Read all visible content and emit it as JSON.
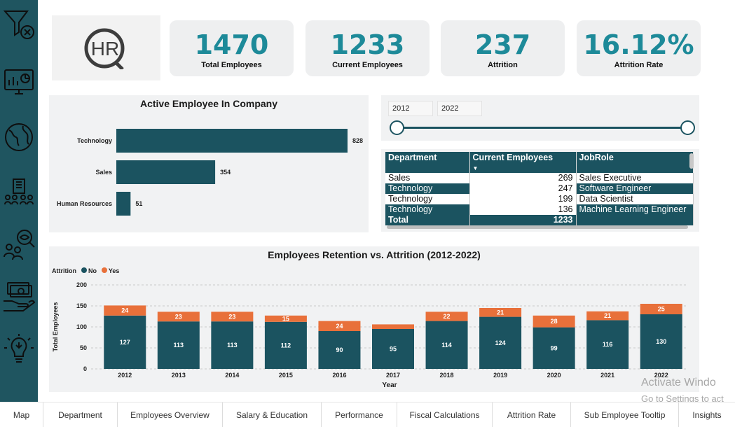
{
  "kpis": [
    {
      "value": "1470",
      "label": "Total Employees"
    },
    {
      "value": "1233",
      "label": "Current Employees"
    },
    {
      "value": "237",
      "label": "Attrition"
    },
    {
      "value": "16.12%",
      "label": "Attrition Rate"
    }
  ],
  "logo_text": "HR",
  "active_chart": {
    "title": "Active Employee In Company"
  },
  "date_slicer": {
    "start": "2012",
    "end": "2022"
  },
  "table": {
    "headers": [
      "Department",
      "Current Employees",
      "JobRole"
    ],
    "rows": [
      [
        "Sales",
        "269",
        "Sales Executive"
      ],
      [
        "Technology",
        "247",
        "Software Engineer"
      ],
      [
        "Technology",
        "199",
        "Data Scientist"
      ],
      [
        "Technology",
        "136",
        "Machine Learning Engineer"
      ]
    ],
    "total_label": "Total",
    "total_value": "1233"
  },
  "retention_chart": {
    "title": "Employees Retention vs. Attrition (2012-2022)",
    "legend_title": "Attrition",
    "legend_no": "No",
    "legend_yes": "Yes",
    "xlabel": "Year",
    "ylabel": "Total Employees"
  },
  "chart_data": [
    {
      "type": "bar",
      "title": "Active Employee In Company",
      "orientation": "horizontal",
      "categories": [
        "Technology",
        "Sales",
        "Human Resources"
      ],
      "values": [
        828,
        354,
        51
      ],
      "color": "#1b5360"
    },
    {
      "type": "bar",
      "stacked": true,
      "title": "Employees Retention vs. Attrition (2012-2022)",
      "xlabel": "Year",
      "ylabel": "Total Employees",
      "categories": [
        "2012",
        "2013",
        "2014",
        "2015",
        "2016",
        "2017",
        "2018",
        "2019",
        "2020",
        "2021",
        "2022"
      ],
      "series": [
        {
          "name": "No",
          "color": "#1b5360",
          "values": [
            127,
            113,
            113,
            112,
            90,
            95,
            114,
            124,
            99,
            116,
            130
          ]
        },
        {
          "name": "Yes",
          "color": "#e8703a",
          "values": [
            24,
            23,
            23,
            15,
            24,
            11,
            22,
            21,
            28,
            21,
            25
          ]
        }
      ],
      "yticks": [
        0,
        50,
        100,
        150,
        200
      ],
      "ylim": [
        0,
        200
      ],
      "legend": "top-left",
      "grid": true
    }
  ],
  "tabs": [
    "Map",
    "Department",
    "Employees Overview",
    "Salary & Education",
    "Performance",
    "Fiscal Calculations",
    "Attrition Rate",
    "Sub Employee Tooltip",
    "Insights"
  ],
  "watermark": {
    "line1": "Activate Windo",
    "line2": "Go to Settings to act"
  },
  "sidebar_icons": [
    "clear-filter-icon",
    "dashboard-icon",
    "globe-icon",
    "organization-icon",
    "employee-search-icon",
    "salary-icon",
    "insights-bulb-icon"
  ],
  "colors": {
    "primary": "#1b5360",
    "accent": "#1d8a99",
    "attrition": "#e8703a",
    "panel": "#f1f2f3"
  }
}
